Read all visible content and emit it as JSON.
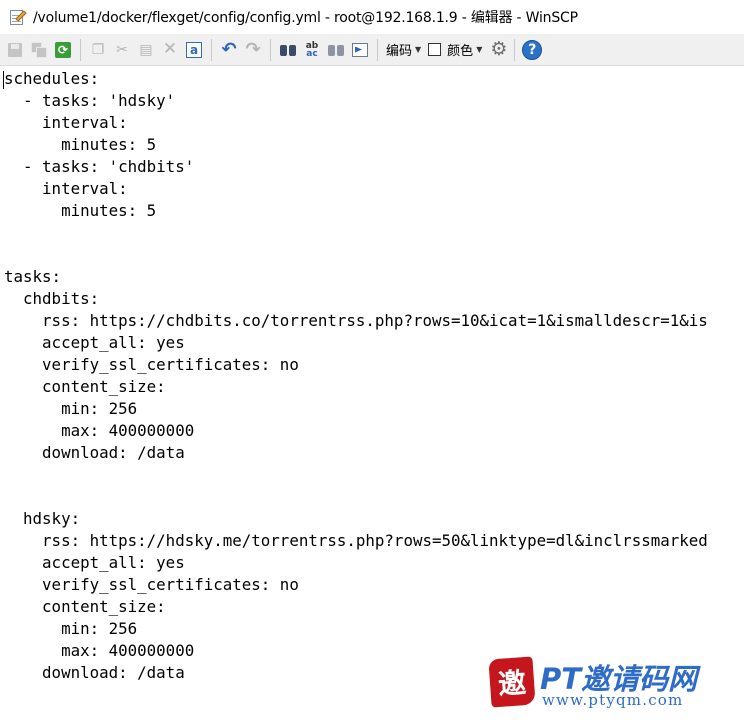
{
  "window": {
    "title": "/volume1/docker/flexget/config/config.yml - root@192.168.1.9 - 编辑器 - WinSCP",
    "icon": "edit-document-icon"
  },
  "toolbar": {
    "encoding_label": "编码",
    "color_label": "颜色",
    "select_all_glyph": "a",
    "help_glyph": "?"
  },
  "editor": {
    "lines": [
      "schedules:",
      "  - tasks: 'hdsky'",
      "    interval:",
      "      minutes: 5",
      "  - tasks: 'chdbits'",
      "    interval:",
      "      minutes: 5",
      "",
      "",
      "tasks:",
      "  chdbits:",
      "    rss: https://chdbits.co/torrentrss.php?rows=10&icat=1&ismalldescr=1&is",
      "    accept_all: yes",
      "    verify_ssl_certificates: no",
      "    content_size:",
      "      min: 256",
      "      max: 400000000",
      "    download: /data",
      "",
      "",
      "  hdsky:",
      "    rss: https://hdsky.me/torrentrss.php?rows=50&linktype=dl&inclrssmarked",
      "    accept_all: yes",
      "    verify_ssl_certificates: no",
      "    content_size:",
      "      min: 256",
      "      max: 400000000",
      "    download: /data"
    ]
  },
  "watermark": {
    "seal_text": "邀",
    "brand": "PT邀请码网",
    "url": "www.ptyqm.com"
  }
}
